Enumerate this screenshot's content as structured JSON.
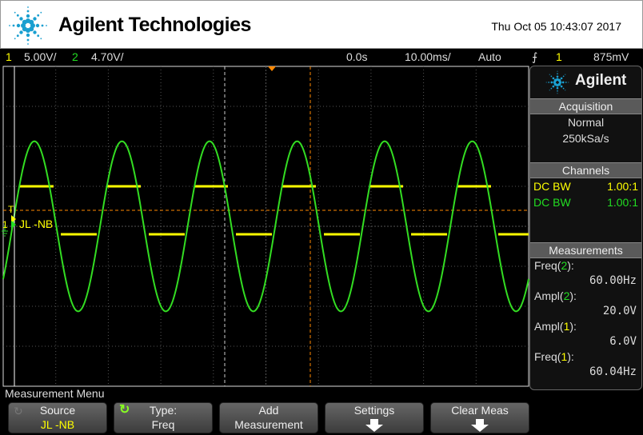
{
  "header": {
    "brand": "Agilent Technologies",
    "datetime": "Thu Oct 05 10:43:07 2017"
  },
  "status": {
    "ch1_num": "1",
    "ch1_scale": "5.00V/",
    "ch2_num": "2",
    "ch2_scale": "4.70V/",
    "delay": "0.0s",
    "timebase": "10.00ms/",
    "trigger_mode": "Auto",
    "trigger_slope_icon": "rising-edge-icon",
    "trigger_source": "1",
    "trigger_level": "875mV"
  },
  "scope": {
    "trigger_marker": "T",
    "ch1_marker": "1",
    "ch1_label": "JL -NB"
  },
  "side": {
    "brand": "Agilent",
    "acquisition": {
      "title": "Acquisition",
      "mode": "Normal",
      "rate": "250kSa/s"
    },
    "channels": {
      "title": "Channels",
      "rows": [
        {
          "coupling": "DC BW",
          "probe": "1.00:1",
          "color": "#ffff00"
        },
        {
          "coupling": "DC BW",
          "probe": "1.00:1",
          "color": "#22dd22"
        }
      ]
    },
    "measurements": {
      "title": "Measurements",
      "items": [
        {
          "name": "Freq",
          "ch": "2",
          "value": "60.00Hz"
        },
        {
          "name": "Ampl",
          "ch": "2",
          "value": "20.0V"
        },
        {
          "name": "Ampl",
          "ch": "1",
          "value": "6.0V"
        },
        {
          "name": "Freq",
          "ch": "1",
          "value": "60.04Hz"
        }
      ]
    }
  },
  "menu": {
    "title": "Measurement Menu",
    "softkeys": [
      {
        "line1": "Source",
        "line2": "JL -NB"
      },
      {
        "line1": "Type:",
        "line2": "Freq"
      },
      {
        "line1": "Add",
        "line2": "Measurement"
      },
      {
        "line1": "Settings",
        "line2": ""
      },
      {
        "line1": "Clear Meas",
        "line2": ""
      }
    ]
  },
  "chart_data": {
    "type": "line",
    "x_unit": "ms",
    "x_per_div": 10,
    "x_divs": 10,
    "y_divs": 8,
    "grid": true,
    "series": [
      {
        "channel": "2",
        "color": "#22dd22",
        "shape": "sine",
        "freq_hz": 60.0,
        "amplitude_v": 20.0,
        "volts_per_div": 4.7
      },
      {
        "channel": "1",
        "color": "#ffff00",
        "shape": "square",
        "freq_hz": 60.04,
        "amplitude_v": 6.0,
        "volts_per_div": 5.0
      }
    ]
  }
}
